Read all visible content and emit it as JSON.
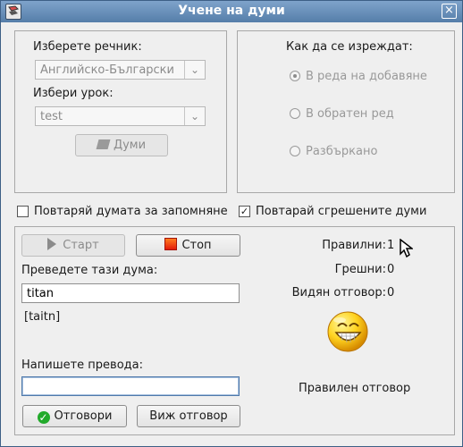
{
  "window": {
    "title": "Учене на думи",
    "close": "×"
  },
  "dictionary": {
    "label": "Изберете речник:",
    "value": "Английско-Български",
    "lesson_label": "Избери урок:",
    "lesson_value": "test",
    "words_button": "Думи"
  },
  "order": {
    "title": "Как да се изреждат:",
    "options": [
      "В реда на добавяне",
      "В обратен ред",
      "Разбъркано"
    ],
    "selected": "В реда на добавяне"
  },
  "settings": {
    "repeat_word": "Повтаряй думата за запомняне",
    "repeat_wrong": "Повтарай сгрешените думи",
    "repeat_word_checked": false,
    "repeat_wrong_checked": true
  },
  "quiz": {
    "start": "Старт",
    "stop": "Стоп",
    "translate_label": "Преведете тази дума:",
    "word": "titan",
    "transcription": "[taitn]",
    "write_label": "Напишете превода:",
    "answer_value": "",
    "answer_button": "Отговори",
    "show_answer_button": "Виж отговор"
  },
  "stats": {
    "correct_label": "Правилни:",
    "correct": "1",
    "wrong_label": "Грешни:",
    "wrong": "0",
    "seen_label": "Видян отговор:",
    "seen": "0",
    "result": "Правилен отговор"
  },
  "icons": {
    "app": "book-icon",
    "words": "book-icon",
    "start": "play-icon",
    "stop": "stop-icon",
    "answer": "check-icon",
    "smiley": "smiley-icon"
  }
}
